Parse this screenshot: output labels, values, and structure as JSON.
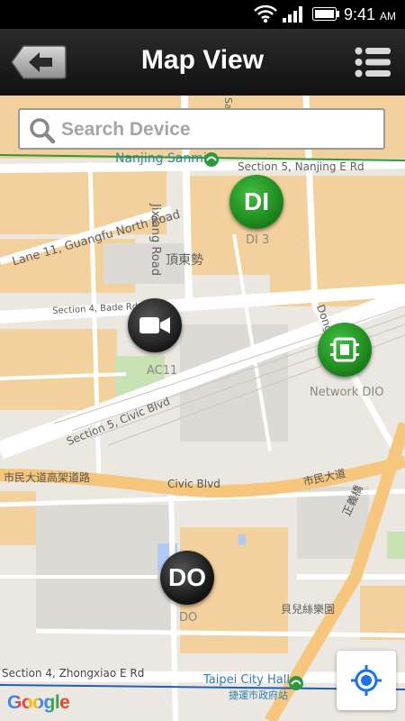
{
  "status_bar": {
    "time": "9:41",
    "ampm": "AM"
  },
  "header": {
    "title": "Map View",
    "back_icon": "back-arrow-icon",
    "menu_icon": "list-icon"
  },
  "search": {
    "placeholder": "Search Device",
    "icon": "search-icon"
  },
  "map_labels": {
    "nanjing_sanmin": "Nanjing Sanmin",
    "section5_nanjing": "Section 5, Nanjing E Rd",
    "jixiang_road": "Jixiang Road",
    "lane11": "Lane 11, Guangfu North Road",
    "dingdongshi": "頂東勢",
    "section4_bade": "Section 4, Bade Rd",
    "dong": "Dong",
    "section5_civic": "Section 5, Civic Blvd",
    "civic_elevated_zh": "市民大道高架道路",
    "civic_blvd": "Civic Blvd",
    "civic_zh": "市民大道",
    "zhengyi": "正義橋",
    "beierxi": "貝兒絲樂園",
    "section4_zhongxiao": "Section 4, Zhongxiao E Rd",
    "taipei_city_hall": "Taipei City Hall",
    "city_hall_zh": "捷運市政府站",
    "sa": "Sa"
  },
  "devices": [
    {
      "id": "di3",
      "label": "DI 3",
      "badge": "DI",
      "icon": "di-marker-icon",
      "color": "#1f8a1f"
    },
    {
      "id": "ac",
      "label": "AC11",
      "badge": "",
      "icon": "video-camera-icon",
      "color": "#222222"
    },
    {
      "id": "netdio",
      "label": "Network DIO",
      "badge": "",
      "icon": "io-module-icon",
      "color": "#1f8a1f"
    },
    {
      "id": "do",
      "label": "DO",
      "badge": "DO",
      "icon": "do-marker-icon",
      "color": "#111111"
    }
  ],
  "footer": {
    "google": "Google",
    "locate_icon": "my-location-icon"
  },
  "colors": {
    "road_major": "#f5c67b",
    "accent_green": "#1f8a1f",
    "locate_blue": "#1a73e8"
  }
}
